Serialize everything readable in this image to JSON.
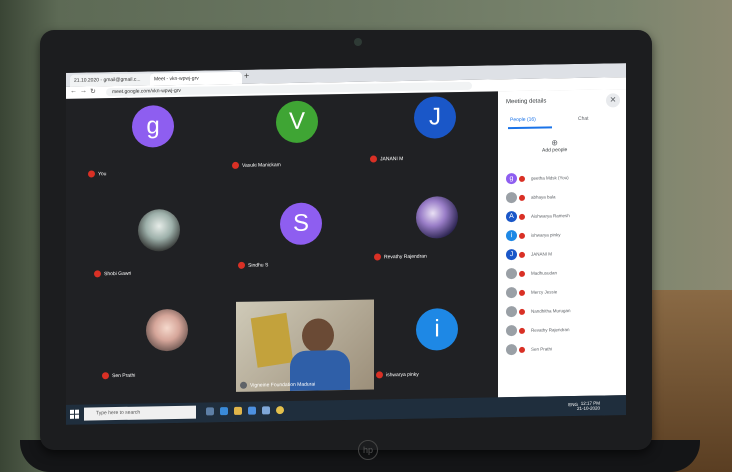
{
  "browser": {
    "tabs": [
      {
        "label": "21.10.2020 - gmail@gmail.c..."
      },
      {
        "label": "Meet - vkn-wpwj-grv"
      }
    ],
    "url": "meet.google.com/vkn-wpwj-grv"
  },
  "meeting": {
    "tiles": [
      {
        "name": "You",
        "initial": "g",
        "color": "#8e5ef0"
      },
      {
        "name": "Vasuki Manickam",
        "initial": "V",
        "color": "#3fa534"
      },
      {
        "name": "JANANI M",
        "initial": "J",
        "color": "#1a57c8"
      },
      {
        "name": "Shobi Gawri",
        "initial": "",
        "color": ""
      },
      {
        "name": "Sindhu S",
        "initial": "S",
        "color": "#8e5ef0"
      },
      {
        "name": "Revathy Rajendran",
        "initial": "",
        "color": ""
      },
      {
        "name": "Sen Prathi",
        "initial": "",
        "color": ""
      },
      {
        "name": "Vigneine Foundation Madurai",
        "initial": "",
        "color": ""
      },
      {
        "name": "ishwarya pinky",
        "initial": "i",
        "color": "#1e88e5"
      }
    ]
  },
  "panel": {
    "title": "Meeting details",
    "tab_people": "People (16)",
    "tab_chat": "Chat",
    "add_people": "Add people",
    "people": [
      {
        "name": "geetha Mdsk (You)",
        "initial": "g",
        "color": "#8e5ef0"
      },
      {
        "name": "abhaya bala",
        "initial": "",
        "color": "#9aa0a6"
      },
      {
        "name": "Aishwarya Ramesh",
        "initial": "A",
        "color": "#1a57c8"
      },
      {
        "name": "ishwarya pinky",
        "initial": "i",
        "color": "#1e88e5"
      },
      {
        "name": "JANANI M",
        "initial": "J",
        "color": "#1a57c8"
      },
      {
        "name": "Madhusudan",
        "initial": "",
        "color": "#9aa0a6"
      },
      {
        "name": "Mercy Jessie",
        "initial": "",
        "color": "#9aa0a6"
      },
      {
        "name": "Nandhitha Murugan",
        "initial": "",
        "color": "#9aa0a6"
      },
      {
        "name": "Revathy Rajendran",
        "initial": "",
        "color": "#9aa0a6"
      },
      {
        "name": "Sen Prathi",
        "initial": "",
        "color": "#9aa0a6"
      }
    ]
  },
  "taskbar": {
    "search_placeholder": "Type here to search",
    "time": "12:17 PM",
    "date": "21-10-2020",
    "lang": "ENG"
  },
  "device": {
    "brand": "hp"
  }
}
